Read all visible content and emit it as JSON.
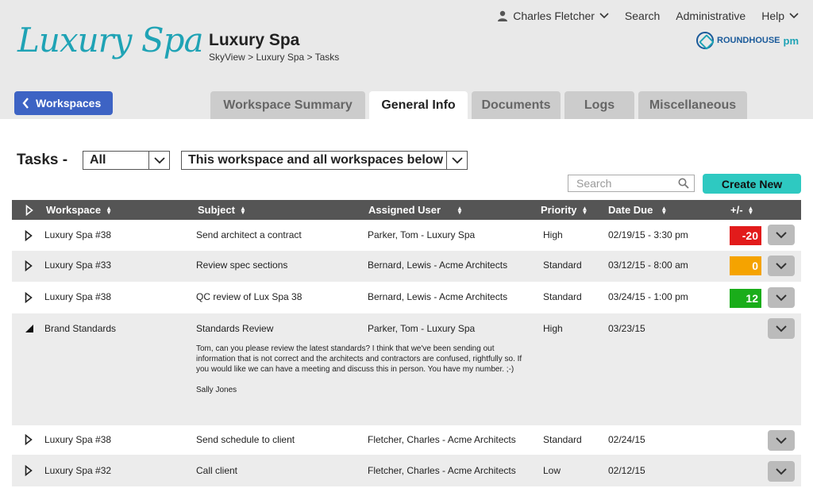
{
  "header": {
    "logo_text": "Luxury Spa",
    "title": "Luxury Spa",
    "breadcrumb": "SkyView > Luxury Spa > Tasks",
    "user_name": "Charles Fletcher",
    "nav": {
      "search": "Search",
      "admin": "Administrative",
      "help": "Help"
    },
    "brand": {
      "main": "ROUNDHOUSE",
      "suffix": "pm"
    }
  },
  "workspaces_button": "Workspaces",
  "tabs": [
    {
      "label": "Workspace Summary",
      "active": false
    },
    {
      "label": "General Info",
      "active": true
    },
    {
      "label": "Documents",
      "active": false
    },
    {
      "label": "Logs",
      "active": false
    },
    {
      "label": "Miscellaneous",
      "active": false
    }
  ],
  "tasks": {
    "label": "Tasks -",
    "filter_value": "All",
    "scope_value": "This workspace and all workspaces below",
    "search_placeholder": "Search",
    "create_label": "Create New"
  },
  "table": {
    "columns": {
      "workspace": "Workspace",
      "subject": "Subject",
      "assigned": "Assigned User",
      "priority": "Priority",
      "due": "Date Due",
      "diff": "+/-"
    },
    "rows": [
      {
        "workspace": "Luxury Spa #38",
        "subject": "Send architect a contract",
        "assigned": "Parker, Tom - Luxury Spa",
        "priority": "High",
        "due": "02/19/15 - 3:30 pm",
        "diff": "-20",
        "diff_color": "#e21b1b",
        "expanded": false
      },
      {
        "workspace": "Luxury Spa #33",
        "subject": "Review spec sections",
        "assigned": "Bernard, Lewis - Acme Architects",
        "priority": "Standard",
        "due": "03/12/15 - 8:00 am",
        "diff": "0",
        "diff_color": "#f5a300",
        "expanded": false
      },
      {
        "workspace": "Luxury Spa #38",
        "subject": "QC review of Lux Spa 38",
        "assigned": "Bernard, Lewis - Acme Architects",
        "priority": "Standard",
        "due": "03/24/15 - 1:00 pm",
        "diff": "12",
        "diff_color": "#1aad1a",
        "expanded": false
      },
      {
        "workspace": "Brand Standards",
        "subject": "Standards Review",
        "assigned": "Parker, Tom - Luxury Spa",
        "priority": "High",
        "due": "03/23/15",
        "diff": "",
        "diff_color": "",
        "expanded": true,
        "note": "Tom, can you please review the latest standards?  I think that we've been sending out information that is not correct and the architects and contractors are confused, rightfully so.  If you would like we can have a meeting and discuss this in person.  You have my number. ;-)\n\nSally Jones"
      },
      {
        "workspace": "Luxury Spa #38",
        "subject": "Send schedule to client",
        "assigned": "Fletcher, Charles - Acme Architects",
        "priority": "Standard",
        "due": "02/24/15",
        "diff": "",
        "diff_color": "",
        "expanded": false
      },
      {
        "workspace": "Luxury Spa #32",
        "subject": "Call client",
        "assigned": "Fletcher, Charles - Acme Architects",
        "priority": "Low",
        "due": "02/12/15",
        "diff": "",
        "diff_color": "",
        "expanded": false
      }
    ]
  },
  "colors": {
    "header_bg": "#e9e9e9",
    "accent": "#3d63c4",
    "create": "#2ec9c1",
    "logo": "#1fa3b5",
    "table_head": "#555555"
  }
}
